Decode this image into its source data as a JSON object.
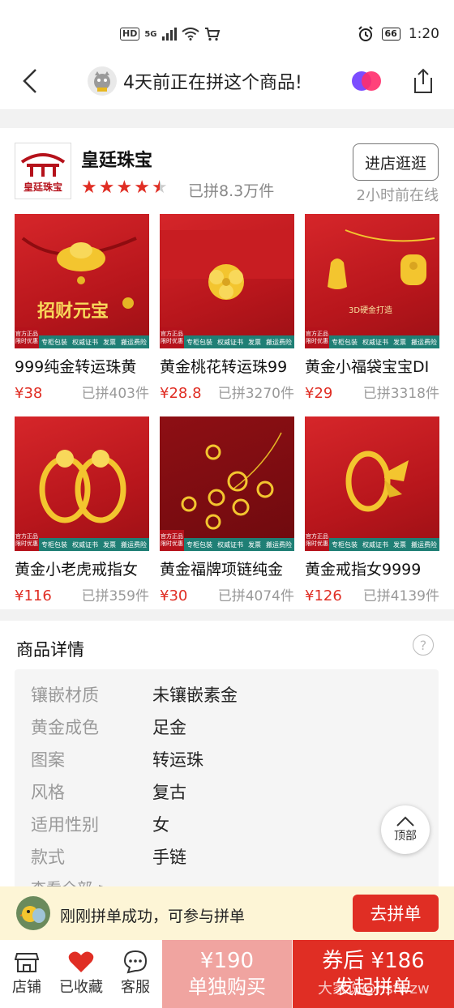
{
  "status_bar": {
    "network": "HD",
    "signal": "5G",
    "time": "1:20",
    "battery": "66"
  },
  "nav": {
    "title": "4天前正在拼这个商品!"
  },
  "shop": {
    "name": "皇廷珠宝",
    "logo_text": "皇廷珠宝",
    "rating": 4.5,
    "sold": "已拼8.3万件",
    "visit_label": "进店逛逛",
    "online": "2小时前在线"
  },
  "products": [
    {
      "name": "999纯金转运珠黄",
      "price": "¥38",
      "sold": "已拼403件",
      "img_text": "招财元宝",
      "icon": "gold-ingot"
    },
    {
      "name": "黄金桃花转运珠99",
      "price": "¥28.8",
      "sold": "已拼3270件",
      "img_text": "",
      "icon": "peach-blossom"
    },
    {
      "name": "黄金小福袋宝宝DI",
      "price": "¥29",
      "sold": "已拼3318件",
      "img_text": "3D硬金打造",
      "icon": "lucky-bag"
    },
    {
      "name": "黄金小老虎戒指女",
      "price": "¥116",
      "sold": "已拼359件",
      "img_text": "",
      "icon": "tiger-ring"
    },
    {
      "name": "黄金福牌项链纯金",
      "price": "¥30",
      "sold": "已拼4074件",
      "img_text": "",
      "icon": "pendant-necklace"
    },
    {
      "name": "黄金戒指女9999",
      "price": "¥126",
      "sold": "已拼4139件",
      "img_text": "",
      "icon": "bow-ring"
    }
  ],
  "product_badge": {
    "line1": "官方正品",
    "line2": "限时优惠"
  },
  "product_foot": [
    "专柜包装",
    "权威证书",
    "发票",
    "搬运费险"
  ],
  "detail": {
    "title": "商品详情",
    "specs": [
      {
        "key": "镶嵌材质",
        "value": "未镶嵌素金"
      },
      {
        "key": "黄金成色",
        "value": "足金"
      },
      {
        "key": "图案",
        "value": "转运珠"
      },
      {
        "key": "风格",
        "value": "复古"
      },
      {
        "key": "适用性别",
        "value": "女"
      },
      {
        "key": "款式",
        "value": "手链"
      }
    ],
    "more": "查看全部 >"
  },
  "back_to_top": "顶部",
  "group_banner": {
    "text": "刚刚拼单成功，可参与拼单",
    "button": "去拼单"
  },
  "bottom_bar": {
    "store": "店铺",
    "favorite": "已收藏",
    "service": "客服",
    "single_price": "¥190",
    "single_label": "单独购买",
    "group_price": "券后 ¥186",
    "group_label": "发起拼单",
    "watermark": "大家说@hsfwzw"
  },
  "colors": {
    "accent": "#e02e24",
    "single_buy": "#f0a4a0",
    "banner_bg": "#fdf5d6"
  }
}
